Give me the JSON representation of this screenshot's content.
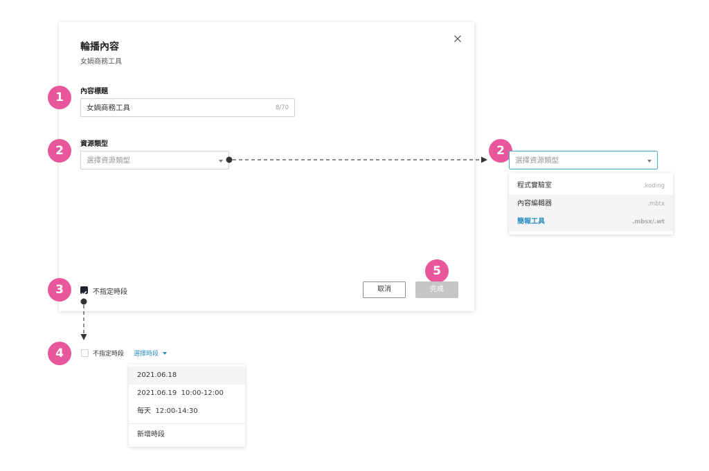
{
  "dialog": {
    "title": "輪播內容",
    "subtitle": "女媧商務工具",
    "content_title": {
      "label": "內容標題",
      "value": "女媧商務工具",
      "counter": "8/70"
    },
    "resource_type": {
      "label": "資源類型",
      "placeholder": "選擇資源類型"
    },
    "no_time_slot_label": "不指定時段",
    "cancel_label": "取消",
    "done_label": "完成"
  },
  "badges": {
    "b1": "1",
    "b2": "2",
    "b2b": "2",
    "b3": "3",
    "b4": "4",
    "b5": "5"
  },
  "resource_dropdown": {
    "placeholder": "選擇資源類型",
    "options": [
      {
        "label": "程式實驗室",
        "ext": ".koding"
      },
      {
        "label": "內容編輯器",
        "ext": ".mbtx"
      },
      {
        "label": "簡報工具",
        "ext": ".mbsx/.wt"
      }
    ]
  },
  "time_slot": {
    "checkbox_label": "不指定時段",
    "select_label": "選擇時段",
    "options": [
      {
        "label": "2021.06.18"
      },
      {
        "label": "2021.06.19  10:00-12:00"
      },
      {
        "label": "每天  12:00-14:30"
      }
    ],
    "add_label": "新增時段"
  },
  "colors": {
    "badge": "#e8579b",
    "accent": "#2a8fbd",
    "focus_border": "#4fa9c9"
  }
}
